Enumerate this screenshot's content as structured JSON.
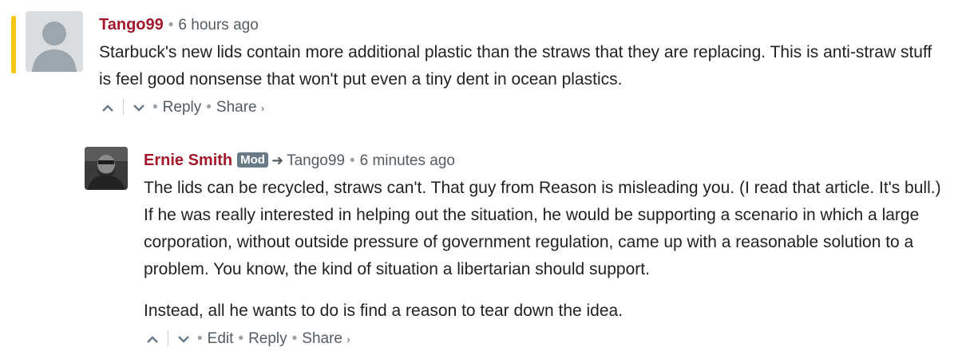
{
  "comments": [
    {
      "author": "Tango99",
      "time": "6 hours ago",
      "text": "Starbuck's new lids contain more additional plastic than the straws that they are replacing. This is anti-straw stuff is feel good nonsense that won't put even a tiny dent in ocean plastics.",
      "actions": {
        "reply": "Reply",
        "share": "Share"
      }
    },
    {
      "author": "Ernie Smith",
      "badge": "Mod",
      "reply_to": "Tango99",
      "time": "6 minutes ago",
      "paragraphs": [
        "The lids can be recycled, straws can't. That guy from Reason is misleading you. (I read that article. It's bull.) If he was really interested in helping out the situation, he would be supporting a scenario in which a large corporation, without outside pressure of government regulation, came up with a reasonable solution to a problem. You know, the kind of situation a libertarian should support.",
        "Instead, all he wants to do is find a reason to tear down the idea."
      ],
      "actions": {
        "edit": "Edit",
        "reply": "Reply",
        "share": "Share"
      }
    }
  ],
  "colors": {
    "highlight": "#f5c518",
    "author": "#a4182c",
    "mod_badge": "#687a86"
  },
  "icons": {
    "upvote": "chevron-up-icon",
    "downvote": "chevron-down-icon",
    "reply_arrow": "arrow-right-icon",
    "share_chevron": "chevron-right-icon"
  }
}
